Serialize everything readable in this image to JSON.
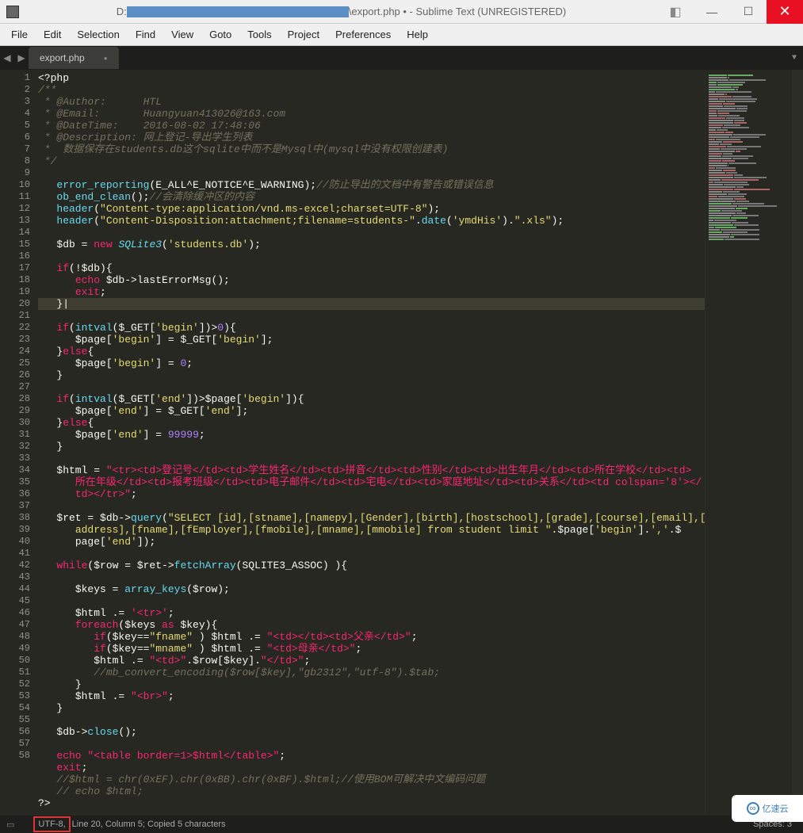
{
  "window": {
    "title_prefix": "D:",
    "title_file": "\\export.php • - Sublime Text (UNREGISTERED)"
  },
  "menu": [
    "File",
    "Edit",
    "Selection",
    "Find",
    "View",
    "Goto",
    "Tools",
    "Project",
    "Preferences",
    "Help"
  ],
  "tab": {
    "name": "export.php",
    "dirty": "●"
  },
  "status": {
    "encoding": "UTF-8,",
    "position": "Line 20, Column 5; Copied 5 characters",
    "spaces": "Spaces: 3"
  },
  "watermark": "亿速云",
  "line_numbers": [
    "1",
    "2",
    "3",
    "4",
    "5",
    "6",
    "7",
    "8",
    "9",
    "10",
    "11",
    "12",
    "13",
    "14",
    "15",
    "16",
    "17",
    "18",
    "19",
    "20",
    "21",
    "22",
    "23",
    "24",
    "25",
    "26",
    "27",
    "28",
    "29",
    "30",
    "31",
    "32",
    "33",
    "34",
    "35",
    "36",
    "37",
    "38",
    "39",
    "40",
    "41",
    "42",
    "43",
    "44",
    "45",
    "46",
    "47",
    "48",
    "49",
    "50",
    "51",
    "52",
    "53",
    "54",
    "55",
    "56",
    "57",
    "58"
  ],
  "code": {
    "l1": {
      "t1": "<?php"
    },
    "l2": {
      "t1": "/**"
    },
    "l3": {
      "t1": " * @Author:      HTL"
    },
    "l4": {
      "t1": " * @Email:       Huangyuan413026@163.com"
    },
    "l5": {
      "t1": " * @DateTime:    2016-08-02 17:48:06"
    },
    "l6": {
      "t1": " * @Description: 网上登记-导出学生列表"
    },
    "l7": {
      "t1": " *  数据保存在students.db这个sqlite中而不是Mysql中(mysql中没有权限创建表)"
    },
    "l8": {
      "t1": " */"
    },
    "l10": {
      "f1": "error_reporting",
      "p": "(E_ALL^E_NOTICE^E_WARNING);",
      "c": "//防止导出的文档中有警告或错误信息"
    },
    "l11": {
      "f1": "ob_end_clean",
      "p": "();",
      "c": "//会清除缓冲区的内容"
    },
    "l12": {
      "f1": "header",
      "p1": "(",
      "s": "\"Content-type:application/vnd.ms-excel;charset=UTF-8\"",
      "p2": ");"
    },
    "l13": {
      "f1": "header",
      "p1": "(",
      "s1": "\"Content-Disposition:attachment;filename=students-\"",
      "d": ".",
      "f2": "date",
      "p2": "(",
      "s2": "'ymdHis'",
      "p3": ").",
      "s3": "\".xls\"",
      "p4": ");"
    },
    "l15": {
      "v": "$db",
      "eq": " = ",
      "kw": "new ",
      "cl": "SQLite3",
      "p1": "(",
      "s": "'students.db'",
      "p2": ");"
    },
    "l17": {
      "kw": "if",
      "p": "(!$db){"
    },
    "l18": {
      "kw": "echo ",
      "t": "$db->lastErrorMsg();"
    },
    "l19": {
      "kw": "exit",
      "p": ";"
    },
    "l20": {
      "t": "}|"
    },
    "l22": {
      "kw": "if",
      "p1": "(",
      "f": "intval",
      "p2": "($_GET[",
      "s": "'begin'",
      "p3": "])>",
      "n": "0",
      "p4": "){"
    },
    "l23": {
      "t1": "$page[",
      "s1": "'begin'",
      "t2": "] = $_GET[",
      "s2": "'begin'",
      "t3": "];"
    },
    "l24": {
      "t": "}",
      "kw": "else",
      "t2": "{"
    },
    "l25": {
      "t1": "$page[",
      "s": "'begin'",
      "t2": "] = ",
      "n": "0",
      "t3": ";"
    },
    "l26": {
      "t": "}"
    },
    "l28": {
      "kw": "if",
      "p1": "(",
      "f": "intval",
      "p2": "($_GET[",
      "s1": "'end'",
      "p3": "])>$page[",
      "s2": "'begin'",
      "p4": "]){"
    },
    "l29": {
      "t1": "$page[",
      "s1": "'end'",
      "t2": "] = $_GET[",
      "s2": "'end'",
      "t3": "];"
    },
    "l30": {
      "t": "}",
      "kw": "else",
      "t2": "{"
    },
    "l31": {
      "t1": "$page[",
      "s": "'end'",
      "t2": "] = ",
      "n": "99999",
      "t3": ";"
    },
    "l32": {
      "t": "}"
    },
    "l34a": {
      "v": "$html",
      "eq": " = ",
      "s": "\"<tr><td>登记号</td><td>学生姓名</td><td>拼音</td><td>性别</td><td>出生年月</td><td>所在学校</td><td>"
    },
    "l34b": {
      "s": "所在年级</td><td>报考班级</td><td>电子邮件</td><td>宅电</td><td>家庭地址</td><td>关系</td><td colspan='8'></"
    },
    "l34c": {
      "s": "td></tr>\"",
      "p": ";"
    },
    "l36a": {
      "v": "$ret",
      "eq": " = $db->",
      "f": "query",
      "p1": "(",
      "s": "\"SELECT [id],[stname],[namepy],[Gender],[birth],[hostschool],[grade],[course],[email],[tel],["
    },
    "l36b": {
      "s1": "address],[fname],[fEmployer],[fmobile],[mname],[mmobile] from student limit \"",
      "d1": ".$page[",
      "s2": "'begin'",
      "d2": "].",
      "s3": "','",
      "d3": ".$"
    },
    "l36c": {
      "t1": "page[",
      "s": "'end'",
      "t2": "]);"
    },
    "l38": {
      "kw": "while",
      "p1": "($row = $ret->",
      "f": "fetchArray",
      "p2": "(SQLITE3_ASSOC) ){"
    },
    "l40": {
      "v": "$keys",
      "eq": " = ",
      "f": "array_keys",
      "p": "($row);"
    },
    "l42": {
      "v": "$html",
      "eq": " .= ",
      "s": "'<tr>'",
      "p": ";"
    },
    "l43": {
      "kw": "foreach",
      "p": "($keys ",
      "kw2": "as ",
      "p2": "$key){"
    },
    "l44": {
      "kw": "if",
      "p1": "($key==",
      "s1": "\"fname\"",
      "p2": " ) $html .= ",
      "s2": "\"<td></td><td>父亲</td>\"",
      "p3": ";"
    },
    "l45": {
      "kw": "if",
      "p1": "($key==",
      "s1": "\"mname\"",
      "p2": " ) $html .= ",
      "s2": "\"<td>母亲</td>\"",
      "p3": ";"
    },
    "l46": {
      "v": "$html",
      "eq": " .= ",
      "s1": "\"<td>\"",
      "d1": ".$row[$key].",
      "s2": "\"</td>\"",
      "p": ";"
    },
    "l47": {
      "c": "//mb_convert_encoding($row[$key],\"gb2312\",\"utf-8\").$tab;"
    },
    "l48": {
      "t": "}"
    },
    "l49": {
      "v": "$html",
      "eq": " .= ",
      "s": "\"<br>\"",
      "p": ";"
    },
    "l50": {
      "t": "}"
    },
    "l52": {
      "t": "$db->",
      "f": "close",
      "p": "();"
    },
    "l54": {
      "kw": "echo ",
      "s": "\"<table border=1>$html</table>\"",
      "p": ";"
    },
    "l55": {
      "kw": "exit",
      "p": ";"
    },
    "l56": {
      "c": "//$html = chr(0xEF).chr(0xBB).chr(0xBF).$html;//使用BOM可解决中文编码问题"
    },
    "l57": {
      "c": "// echo $html;"
    },
    "l58": {
      "t": "?>"
    }
  }
}
